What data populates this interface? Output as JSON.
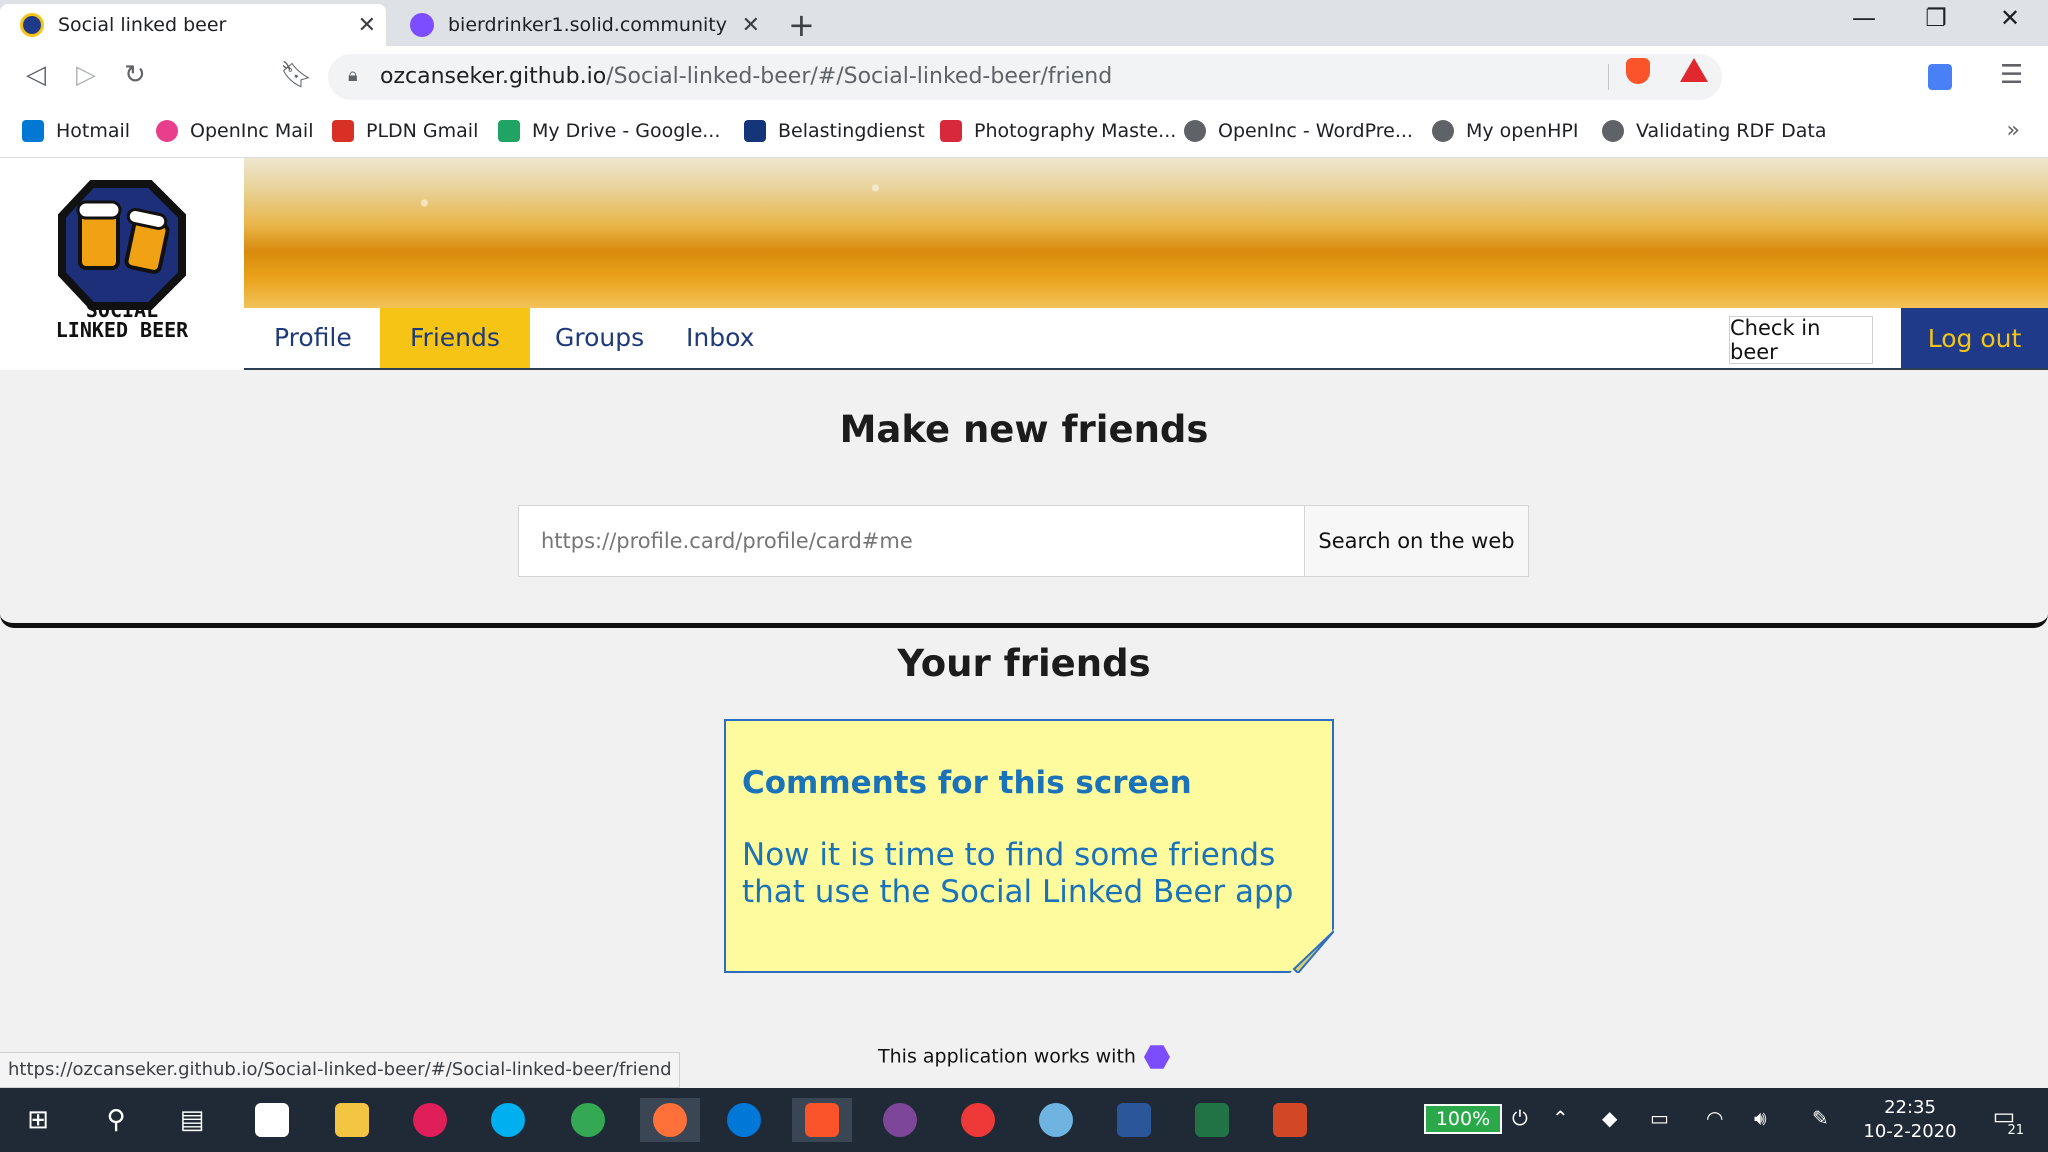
{
  "browser": {
    "tabs": [
      {
        "title": "Social linked beer",
        "active": true
      },
      {
        "title": "bierdrinker1.solid.community",
        "active": false
      }
    ],
    "address": {
      "domain": "ozcanseker.github.io",
      "path": "/Social-linked-beer/#/Social-linked-beer/friend"
    },
    "bookmarks": [
      {
        "label": "Hotmail",
        "icon": "outlook-icon",
        "color": "#0078d4"
      },
      {
        "label": "OpenInc Mail",
        "icon": "openinc-icon",
        "color": "#e83e8c"
      },
      {
        "label": "PLDN Gmail",
        "icon": "gmail-icon",
        "color": "#d93025"
      },
      {
        "label": "My Drive - Google...",
        "icon": "drive-icon",
        "color": "#1fa463"
      },
      {
        "label": "Belastingdienst",
        "icon": "belastingdienst-icon",
        "color": "#15357a"
      },
      {
        "label": "Photography Maste...",
        "icon": "photography-icon",
        "color": "#d8283c"
      },
      {
        "label": "OpenInc - WordPre...",
        "icon": "globe-icon",
        "color": "#5f6368"
      },
      {
        "label": "My openHPI",
        "icon": "globe-icon",
        "color": "#5f6368"
      },
      {
        "label": "Validating RDF Data",
        "icon": "globe-icon",
        "color": "#5f6368"
      }
    ],
    "status_url": "https://ozcanseker.github.io/Social-linked-beer/#/Social-linked-beer/friend"
  },
  "app": {
    "logo_text_line1": "SOCIAL",
    "logo_text_line2": "LINKED BEER",
    "nav": [
      "Profile",
      "Friends",
      "Groups",
      "Inbox"
    ],
    "active_nav": "Friends",
    "check_in_label": "Check in beer",
    "logout_label": "Log out",
    "make_friends_title": "Make new friends",
    "search_placeholder": "https://profile.card/profile/card#me",
    "search_button": "Search on the web",
    "your_friends_title": "Your friends",
    "note": {
      "title": "Comments for this screen",
      "body": "Now it is time to find some friends that use the Social Linked Beer app"
    },
    "footer_text": "This application works with"
  },
  "taskbar": {
    "battery": "100%",
    "time": "22:35",
    "date": "10-2-2020",
    "notifications": "21"
  },
  "colors": {
    "nav_active": "#f5c414",
    "logout_bg": "#203a8a",
    "note_bg": "#fdfb9e",
    "note_text": "#1a73b8"
  }
}
